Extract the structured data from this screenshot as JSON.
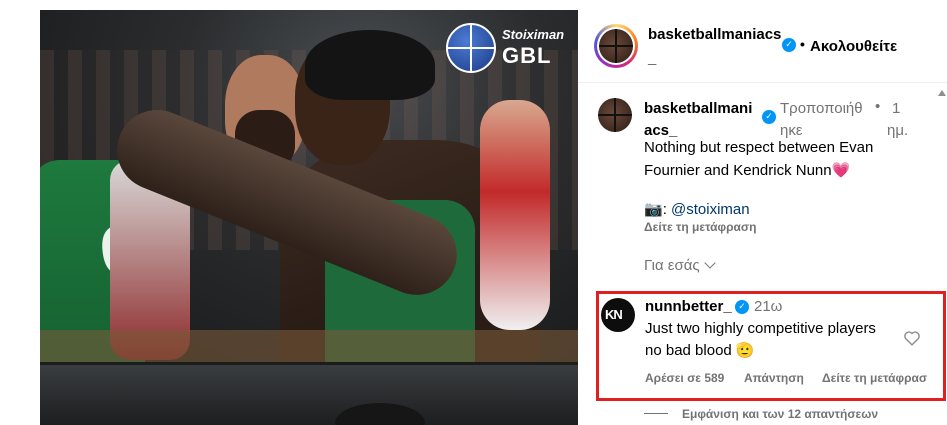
{
  "media": {
    "logo": {
      "brand": "Stoiximan",
      "name": "GBL"
    },
    "jersey_number": "6"
  },
  "header": {
    "username": "basketballmaniacs",
    "username_tail": "_",
    "separator": "•",
    "follow_label": "Ακολουθείτε",
    "verified_icon": "✓"
  },
  "caption": {
    "username_line1": "basketballmani",
    "username_line2": "acs_",
    "edited_line1": "Τροποποιήθ",
    "edited_line2": "ηκε",
    "separator": "•",
    "time_line1": "1",
    "time_line2": "ημ.",
    "text_line1": "Nothing but respect between Evan",
    "text_line2": "Fournier and Kendrick Nunn",
    "emoji": "💗",
    "credit_emoji": "📷",
    "credit_sep": ": ",
    "mention": "@stoiximan",
    "translate": "Δείτε τη μετάφραση",
    "for_you": "Για εσάς"
  },
  "comment": {
    "avatar_text": "KN",
    "username": "nunnbetter_",
    "time": "21ω",
    "text_line1": "Just two highly competitive players",
    "text_line2": "no bad blood",
    "emoji": "🫡",
    "likes": "Αρέσει σε 589",
    "reply": "Απάντηση",
    "translate": "Δείτε τη μετάφρασ",
    "highlight_color": "#e02020"
  },
  "view_replies": "Εμφάνιση και των 12 απαντήσεων",
  "colors": {
    "verified": "#0095f6",
    "heart": "#ed4956",
    "secondary": "#737373",
    "link": "#00376b"
  }
}
